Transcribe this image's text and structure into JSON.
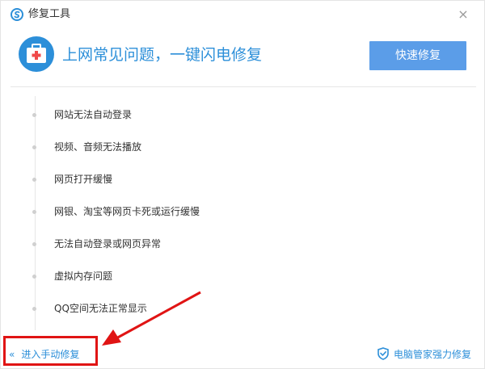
{
  "window": {
    "title": "修复工具",
    "close_glyph": "×"
  },
  "header": {
    "headline": "上网常见问题，一键闪电修复",
    "quick_fix_label": "快速修复",
    "icon": "first-aid-kit-icon"
  },
  "problems": [
    {
      "label": "网站无法自动登录"
    },
    {
      "label": "视频、音频无法播放"
    },
    {
      "label": "网页打开缓慢"
    },
    {
      "label": "网银、淘宝等网页卡死或运行缓慢"
    },
    {
      "label": "无法自动登录或网页异常"
    },
    {
      "label": "虚拟内存问题"
    },
    {
      "label": "QQ空间无法正常显示"
    }
  ],
  "footer": {
    "manual_chevron": "«",
    "manual_label": "进入手动修复",
    "pc_manager_label": "电脑管家强力修复"
  },
  "colors": {
    "accent": "#2c8fd9",
    "button": "#5b9de8",
    "annotation": "#e01414"
  }
}
